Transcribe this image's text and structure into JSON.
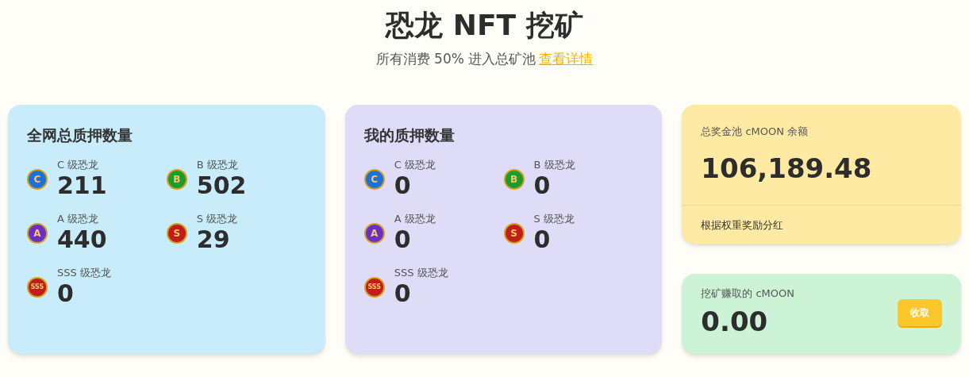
{
  "header": {
    "title": "恐龙 NFT 挖矿",
    "subtitle": "所有消费 50% 进入总矿池",
    "link": "查看详情"
  },
  "stake_cards": [
    {
      "title": "全网总质押数量",
      "tiers": [
        {
          "badge": "C",
          "color": "#1e6fd9",
          "label": "C 级恐龙",
          "count": "211"
        },
        {
          "badge": "B",
          "color": "#1f9a2e",
          "label": "B 级恐龙",
          "count": "502"
        },
        {
          "badge": "A",
          "color": "#6a2fc9",
          "label": "A 级恐龙",
          "count": "440"
        },
        {
          "badge": "S",
          "color": "#c21d1d",
          "label": "S 级恐龙",
          "count": "29"
        },
        {
          "badge": "SSS",
          "color": "#c21d1d",
          "label": "SSS 级恐龙",
          "count": "0"
        }
      ]
    },
    {
      "title": "我的质押数量",
      "tiers": [
        {
          "badge": "C",
          "color": "#1e6fd9",
          "label": "C 级恐龙",
          "count": "0"
        },
        {
          "badge": "B",
          "color": "#1f9a2e",
          "label": "B 级恐龙",
          "count": "0"
        },
        {
          "badge": "A",
          "color": "#6a2fc9",
          "label": "A 级恐龙",
          "count": "0"
        },
        {
          "badge": "S",
          "color": "#c21d1d",
          "label": "S 级恐龙",
          "count": "0"
        },
        {
          "badge": "SSS",
          "color": "#c21d1d",
          "label": "SSS 级恐龙",
          "count": "0"
        }
      ]
    }
  ],
  "pool": {
    "label": "总奖金池 cMOON 余额",
    "amount": "106,189.48",
    "note": "根据权重奖励分红"
  },
  "mined": {
    "label": "挖矿赚取的 cMOON",
    "amount": "0.00",
    "button": "收取"
  }
}
